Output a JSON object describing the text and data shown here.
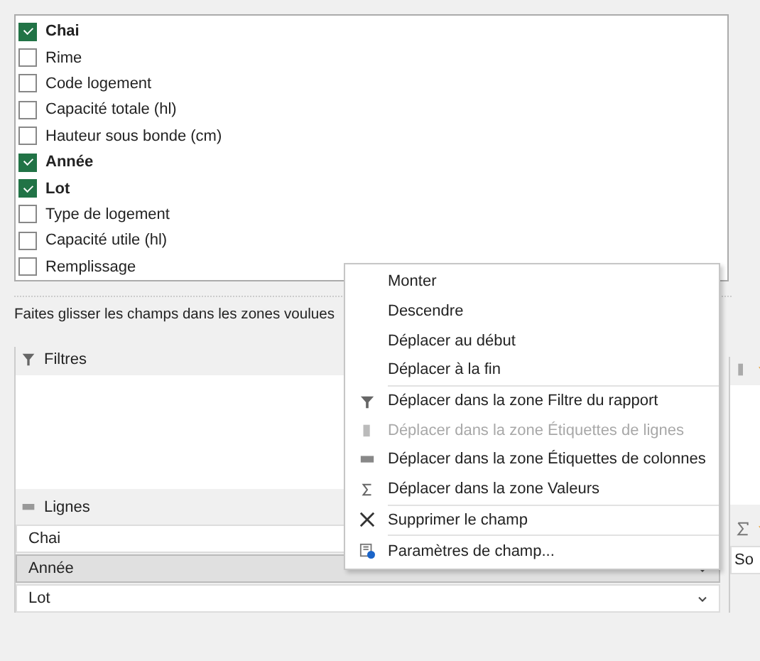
{
  "fields": [
    {
      "label": "Chai",
      "checked": true
    },
    {
      "label": "Rime",
      "checked": false
    },
    {
      "label": "Code logement",
      "checked": false
    },
    {
      "label": "Capacité totale (hl)",
      "checked": false
    },
    {
      "label": "Hauteur sous bonde (cm)",
      "checked": false
    },
    {
      "label": "Année",
      "checked": true
    },
    {
      "label": "Lot",
      "checked": true
    },
    {
      "label": "Type de logement",
      "checked": false
    },
    {
      "label": "Capacité utile (hl)",
      "checked": false
    },
    {
      "label": "Remplissage",
      "checked": false
    }
  ],
  "instruction": "Faites glisser les champs dans les zones voulues",
  "areas": {
    "filters": {
      "title": "Filtres"
    },
    "rows": {
      "title": "Lignes",
      "items": [
        {
          "label": "Chai",
          "selected": false
        },
        {
          "label": "Année",
          "selected": true
        },
        {
          "label": "Lot",
          "selected": false
        }
      ]
    },
    "values": {
      "items": [
        {
          "label": "So"
        }
      ]
    }
  },
  "context_menu": [
    {
      "kind": "item",
      "label": "Monter",
      "disabled": false
    },
    {
      "kind": "item",
      "label": "Descendre",
      "disabled": false
    },
    {
      "kind": "item",
      "label": "Déplacer au début",
      "disabled": false
    },
    {
      "kind": "item",
      "label": "Déplacer à la fin",
      "disabled": false
    },
    {
      "kind": "separator"
    },
    {
      "kind": "filter",
      "label": "Déplacer dans la zone Filtre du rapport",
      "disabled": false
    },
    {
      "kind": "rows",
      "label": "Déplacer dans la zone Étiquettes de lignes",
      "disabled": true
    },
    {
      "kind": "columns",
      "label": "Déplacer dans la zone Étiquettes de colonnes",
      "disabled": false
    },
    {
      "kind": "values",
      "label": "Déplacer dans la zone Valeurs",
      "disabled": false
    },
    {
      "kind": "separator"
    },
    {
      "kind": "delete",
      "label": "Supprimer le champ",
      "disabled": false
    },
    {
      "kind": "separator"
    },
    {
      "kind": "settings",
      "label": "Paramètres de champ...",
      "disabled": false
    }
  ]
}
